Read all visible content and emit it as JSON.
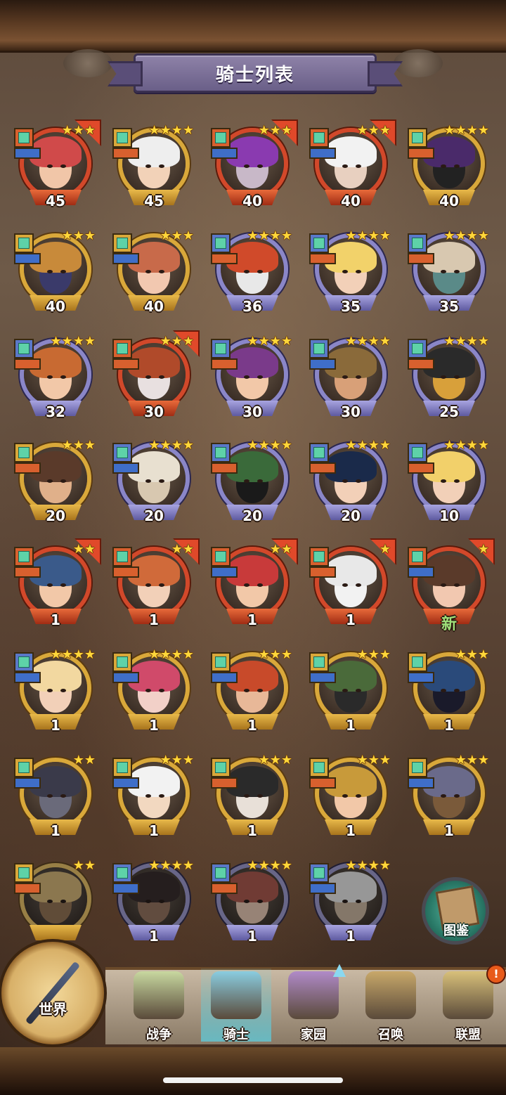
{
  "title": "骑士列表",
  "colors": {
    "gold_frame": "#d9a83a",
    "red_frame": "#d2482a",
    "purple_frame": "#8a86c8",
    "star": "#ffd73a",
    "banner": "#7a6f98"
  },
  "knights": [
    {
      "level": "45",
      "frame": "red",
      "stars": 3,
      "badge": "orange",
      "role": "blue",
      "flag": true,
      "hair": "#d04a4a",
      "skin": "#f1c6a8"
    },
    {
      "level": "45",
      "frame": "gold",
      "stars": 4,
      "badge": "gold",
      "role": "orange",
      "flag": false,
      "hair": "#eeeeee",
      "skin": "#f2d2b8"
    },
    {
      "level": "40",
      "frame": "red",
      "stars": 3,
      "badge": "orange",
      "role": "blue",
      "flag": true,
      "hair": "#8a3ab0",
      "skin": "#c8b8c8"
    },
    {
      "level": "40",
      "frame": "red",
      "stars": 3,
      "badge": "orange",
      "role": "blue",
      "flag": true,
      "hair": "#f2f2f2",
      "skin": "#e8d0c0"
    },
    {
      "level": "40",
      "frame": "gold",
      "stars": 4,
      "badge": "gold",
      "role": "orange",
      "flag": false,
      "hair": "#4a2a6a",
      "skin": "#222222"
    },
    {
      "level": "40",
      "frame": "gold",
      "stars": 3,
      "badge": "gold",
      "role": "blue",
      "flag": false,
      "hair": "#c88a3a",
      "skin": "#3a3a6a"
    },
    {
      "level": "40",
      "frame": "gold",
      "stars": 3,
      "badge": "gold",
      "role": "blue",
      "flag": false,
      "hair": "#c86a4a",
      "skin": "#f2c8b0"
    },
    {
      "level": "36",
      "frame": "purple",
      "stars": 4,
      "badge": "blue",
      "role": "orange",
      "flag": false,
      "hair": "#d04a2a",
      "skin": "#e8e8e8"
    },
    {
      "level": "35",
      "frame": "purple",
      "stars": 4,
      "badge": "blue",
      "role": "orange",
      "flag": false,
      "hair": "#f2d26a",
      "skin": "#f2d0b8"
    },
    {
      "level": "35",
      "frame": "purple",
      "stars": 4,
      "badge": "blue",
      "role": "orange",
      "flag": false,
      "hair": "#d8c8b0",
      "skin": "#5a8a88"
    },
    {
      "level": "32",
      "frame": "purple",
      "stars": 4,
      "badge": "blue",
      "role": "orange",
      "flag": false,
      "hair": "#c86a32",
      "skin": "#f2c8a8"
    },
    {
      "level": "30",
      "frame": "red",
      "stars": 3,
      "badge": "orange",
      "role": "orange",
      "flag": true,
      "hair": "#b04a2a",
      "skin": "#e8e0e0"
    },
    {
      "level": "30",
      "frame": "purple",
      "stars": 4,
      "badge": "blue",
      "role": "orange",
      "flag": false,
      "hair": "#7a3a8a",
      "skin": "#f2c8a8"
    },
    {
      "level": "30",
      "frame": "purple",
      "stars": 4,
      "badge": "blue",
      "role": "blue",
      "flag": false,
      "hair": "#8a6a3a",
      "skin": "#d8a078"
    },
    {
      "level": "25",
      "frame": "purple",
      "stars": 4,
      "badge": "blue",
      "role": "orange",
      "flag": false,
      "hair": "#2a2a2a",
      "skin": "#d8a03a"
    },
    {
      "level": "20",
      "frame": "gold",
      "stars": 3,
      "badge": "gold",
      "role": "orange",
      "flag": false,
      "hair": "#5a3a2a",
      "skin": "#e0b08a"
    },
    {
      "level": "20",
      "frame": "purple",
      "stars": 4,
      "badge": "blue",
      "role": "blue",
      "flag": false,
      "hair": "#e8e0d0",
      "skin": "#d8c8b0"
    },
    {
      "level": "20",
      "frame": "purple",
      "stars": 4,
      "badge": "blue",
      "role": "orange",
      "flag": false,
      "hair": "#3a6a3a",
      "skin": "#1a1a1a"
    },
    {
      "level": "20",
      "frame": "purple",
      "stars": 4,
      "badge": "blue",
      "role": "orange",
      "flag": false,
      "hair": "#1a2a4a",
      "skin": "#f2d0b8"
    },
    {
      "level": "10",
      "frame": "purple",
      "stars": 4,
      "badge": "blue",
      "role": "orange",
      "flag": false,
      "hair": "#f2d06a",
      "skin": "#f2d0b8"
    },
    {
      "level": "1",
      "frame": "red",
      "stars": 2,
      "badge": "orange",
      "role": "orange",
      "flag": true,
      "hair": "#3a5a8a",
      "skin": "#f2c8a8"
    },
    {
      "level": "1",
      "frame": "red",
      "stars": 2,
      "badge": "orange",
      "role": "orange",
      "flag": true,
      "hair": "#d06a3a",
      "skin": "#f2d0b8"
    },
    {
      "level": "1",
      "frame": "red",
      "stars": 2,
      "badge": "orange",
      "role": "blue",
      "flag": true,
      "hair": "#c83a3a",
      "skin": "#f2c8a8"
    },
    {
      "level": "1",
      "frame": "red",
      "stars": 1,
      "badge": "orange",
      "role": "orange",
      "flag": true,
      "hair": "#e8e8e8",
      "skin": "#f2f2f2"
    },
    {
      "level": "新",
      "frame": "red",
      "stars": 1,
      "badge": "orange",
      "role": "blue",
      "flag": true,
      "hair": "#5a3a2a",
      "skin": "#f2c8b0",
      "newtag": true
    },
    {
      "level": "1",
      "frame": "gold",
      "stars": 4,
      "badge": "blue",
      "role": "blue",
      "flag": false,
      "hair": "#f2d8a0",
      "skin": "#f2d0b8"
    },
    {
      "level": "1",
      "frame": "gold",
      "stars": 4,
      "badge": "gold",
      "role": "blue",
      "flag": false,
      "hair": "#d04a6a",
      "skin": "#f2d0c8"
    },
    {
      "level": "1",
      "frame": "gold",
      "stars": 3,
      "badge": "gold",
      "role": "blue",
      "flag": false,
      "hair": "#c84a2a",
      "skin": "#e8b898"
    },
    {
      "level": "1",
      "frame": "gold",
      "stars": 3,
      "badge": "gold",
      "role": "blue",
      "flag": false,
      "hair": "#4a6a3a",
      "skin": "#2a2a2a"
    },
    {
      "level": "1",
      "frame": "gold",
      "stars": 3,
      "badge": "gold",
      "role": "blue",
      "flag": false,
      "hair": "#2a4a7a",
      "skin": "#1a1a2a"
    },
    {
      "level": "1",
      "frame": "gold",
      "stars": 2,
      "badge": "gold",
      "role": "blue",
      "flag": false,
      "hair": "#3a3a4a",
      "skin": "#6a6a7a"
    },
    {
      "level": "1",
      "frame": "gold",
      "stars": 3,
      "badge": "gold",
      "role": "blue",
      "flag": false,
      "hair": "#f2f2f2",
      "skin": "#f2d8c0"
    },
    {
      "level": "1",
      "frame": "gold",
      "stars": 3,
      "badge": "gold",
      "role": "orange",
      "flag": false,
      "hair": "#2a2a2a",
      "skin": "#e8e0d8"
    },
    {
      "level": "1",
      "frame": "gold",
      "stars": 3,
      "badge": "gold",
      "role": "orange",
      "flag": false,
      "hair": "#c89a3a",
      "skin": "#f2c8a8"
    },
    {
      "level": "1",
      "frame": "gold",
      "stars": 3,
      "badge": "gold",
      "role": "blue",
      "flag": false,
      "hair": "#6a6a8a",
      "skin": "#7a5a3a"
    },
    {
      "level": "",
      "frame": "gold",
      "stars": 2,
      "badge": "gold",
      "role": "orange",
      "flag": false,
      "hair": "#d8a84a",
      "skin": "#9a6a3a",
      "dim": true
    },
    {
      "level": "1",
      "frame": "purple",
      "stars": 4,
      "badge": "blue",
      "role": "blue",
      "flag": false,
      "hair": "#3a2a2a",
      "skin": "#9a6a4a",
      "dim": true
    },
    {
      "level": "1",
      "frame": "purple",
      "stars": 4,
      "badge": "blue",
      "role": "orange",
      "flag": false,
      "hair": "#c84a3a",
      "skin": "#e8b898",
      "dim": true
    },
    {
      "level": "1",
      "frame": "purple",
      "stars": 4,
      "badge": "blue",
      "role": "blue",
      "flag": false,
      "hair": "#d8d8d8",
      "skin": "#c8a888",
      "dim": true
    }
  ],
  "codex": {
    "label": "图鉴"
  },
  "nav": {
    "world": "世界",
    "tabs": [
      {
        "label": "战争",
        "icon": "map-icon",
        "color": "#c8d8a0"
      },
      {
        "label": "骑士",
        "icon": "knight-icon",
        "color": "#8acde0"
      },
      {
        "label": "家园",
        "icon": "house-icon",
        "color": "#b08ac8"
      },
      {
        "label": "召唤",
        "icon": "train-icon",
        "color": "#c8a86a"
      },
      {
        "label": "联盟",
        "icon": "castle-icon",
        "color": "#d8c07a"
      }
    ],
    "alert": "!"
  }
}
